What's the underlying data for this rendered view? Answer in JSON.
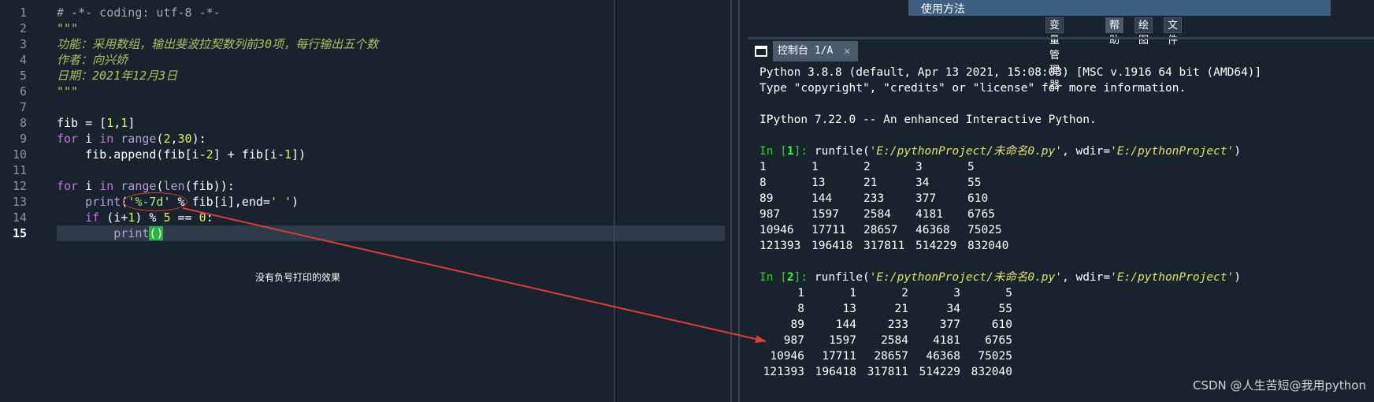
{
  "editor": {
    "line_numbers": [
      "1",
      "2",
      "3",
      "4",
      "5",
      "6",
      "7",
      "8",
      "9",
      "10",
      "11",
      "12",
      "13",
      "14",
      "15"
    ],
    "current_line": "15",
    "lines": [
      {
        "tokens": [
          {
            "t": "# -*- coding: utf-8 -*-",
            "c": "cm"
          }
        ]
      },
      {
        "tokens": [
          {
            "t": "\"\"\"",
            "c": "ds"
          }
        ]
      },
      {
        "tokens": [
          {
            "t": "功能：采用数组，输出斐波拉契数列前30项，每行输出五个数",
            "c": "ds"
          }
        ]
      },
      {
        "tokens": [
          {
            "t": "作者：向兴娇",
            "c": "ds"
          }
        ]
      },
      {
        "tokens": [
          {
            "t": "日期：2021年12月3日",
            "c": "ds"
          }
        ]
      },
      {
        "tokens": [
          {
            "t": "\"\"\"",
            "c": "ds"
          }
        ]
      },
      {
        "tokens": []
      },
      {
        "tokens": [
          {
            "t": "fib = [",
            "c": ""
          },
          {
            "t": "1",
            "c": "nm"
          },
          {
            "t": ",",
            "c": ""
          },
          {
            "t": "1",
            "c": "nm"
          },
          {
            "t": "]",
            "c": ""
          }
        ]
      },
      {
        "tokens": [
          {
            "t": "for",
            "c": "kw"
          },
          {
            "t": " i ",
            "c": ""
          },
          {
            "t": "in",
            "c": "kw"
          },
          {
            "t": " ",
            "c": ""
          },
          {
            "t": "range",
            "c": "bi"
          },
          {
            "t": "(",
            "c": ""
          },
          {
            "t": "2",
            "c": "nm"
          },
          {
            "t": ",",
            "c": ""
          },
          {
            "t": "30",
            "c": "nm"
          },
          {
            "t": "):",
            "c": ""
          }
        ]
      },
      {
        "tokens": [
          {
            "t": "    fib.append(fib[i-",
            "c": ""
          },
          {
            "t": "2",
            "c": "nm"
          },
          {
            "t": "] + fib[i-",
            "c": ""
          },
          {
            "t": "1",
            "c": "nm"
          },
          {
            "t": "])",
            "c": ""
          }
        ]
      },
      {
        "tokens": []
      },
      {
        "tokens": [
          {
            "t": "for",
            "c": "kw"
          },
          {
            "t": " i ",
            "c": ""
          },
          {
            "t": "in",
            "c": "kw"
          },
          {
            "t": " ",
            "c": ""
          },
          {
            "t": "range",
            "c": "bi"
          },
          {
            "t": "(",
            "c": ""
          },
          {
            "t": "len",
            "c": "bi"
          },
          {
            "t": "(fib)):",
            "c": ""
          }
        ]
      },
      {
        "tokens": [
          {
            "t": "    ",
            "c": ""
          },
          {
            "t": "print",
            "c": "bi"
          },
          {
            "t": "(",
            "c": ""
          },
          {
            "t": "'%-7d'",
            "c": "st"
          },
          {
            "t": " % fib[i],end=",
            "c": ""
          },
          {
            "t": "' '",
            "c": "st"
          },
          {
            "t": ")",
            "c": ""
          }
        ]
      },
      {
        "tokens": [
          {
            "t": "    ",
            "c": ""
          },
          {
            "t": "if",
            "c": "kw"
          },
          {
            "t": " (i+",
            "c": ""
          },
          {
            "t": "1",
            "c": "nm"
          },
          {
            "t": ") % ",
            "c": ""
          },
          {
            "t": "5",
            "c": "nm"
          },
          {
            "t": " == ",
            "c": ""
          },
          {
            "t": "0",
            "c": "nm"
          },
          {
            "t": ":",
            "c": ""
          }
        ]
      },
      {
        "tokens": [
          {
            "t": "        ",
            "c": ""
          },
          {
            "t": "print",
            "c": "bi"
          },
          {
            "t": "()",
            "c": "hl"
          }
        ]
      }
    ],
    "annotation": "没有负号打印的效果"
  },
  "help_banner": "使用方法",
  "pane_tabs": [
    {
      "label": "变量管理器",
      "active": false
    },
    {
      "label": "帮助",
      "active": true
    },
    {
      "label": "绘图",
      "active": false
    },
    {
      "label": "文件",
      "active": false
    }
  ],
  "console_tab": {
    "label": "控制台 1/A",
    "close": "✕"
  },
  "console": {
    "banner": [
      "Python 3.8.8 (default, Apr 13 2021, 15:08:03) [MSC v.1916 64 bit (AMD64)]",
      "Type \"copyright\", \"credits\" or \"license\" for more information.",
      "",
      "IPython 7.22.0 -- An enhanced Interactive Python."
    ],
    "runs": [
      {
        "prompt": "In [",
        "number": "1",
        "prompt_end": "]:",
        "call": " runfile(",
        "path": "'E:/pythonProject/未命名0.py'",
        "mid": ", wdir=",
        "wdir": "'E:/pythonProject'",
        "end": ")",
        "align": "left",
        "rows": [
          [
            "1",
            "1",
            "2",
            "3",
            "5"
          ],
          [
            "8",
            "13",
            "21",
            "34",
            "55"
          ],
          [
            "89",
            "144",
            "233",
            "377",
            "610"
          ],
          [
            "987",
            "1597",
            "2584",
            "4181",
            "6765"
          ],
          [
            "10946",
            "17711",
            "28657",
            "46368",
            "75025"
          ],
          [
            "121393",
            "196418",
            "317811",
            "514229",
            "832040"
          ]
        ]
      },
      {
        "prompt": "In [",
        "number": "2",
        "prompt_end": "]:",
        "call": " runfile(",
        "path": "'E:/pythonProject/未命名0.py'",
        "mid": ", wdir=",
        "wdir": "'E:/pythonProject'",
        "end": ")",
        "align": "right",
        "rows": [
          [
            "1",
            "1",
            "2",
            "3",
            "5"
          ],
          [
            "8",
            "13",
            "21",
            "34",
            "55"
          ],
          [
            "89",
            "144",
            "233",
            "377",
            "610"
          ],
          [
            "987",
            "1597",
            "2584",
            "4181",
            "6765"
          ],
          [
            "10946",
            "17711",
            "28657",
            "46368",
            "75025"
          ],
          [
            "121393",
            "196418",
            "317811",
            "514229",
            "832040"
          ]
        ]
      }
    ]
  },
  "watermark": "CSDN @人生苦短@我用python",
  "colors": {
    "annotation_red": "#e03b3b",
    "editor_bg": "#19232d"
  }
}
